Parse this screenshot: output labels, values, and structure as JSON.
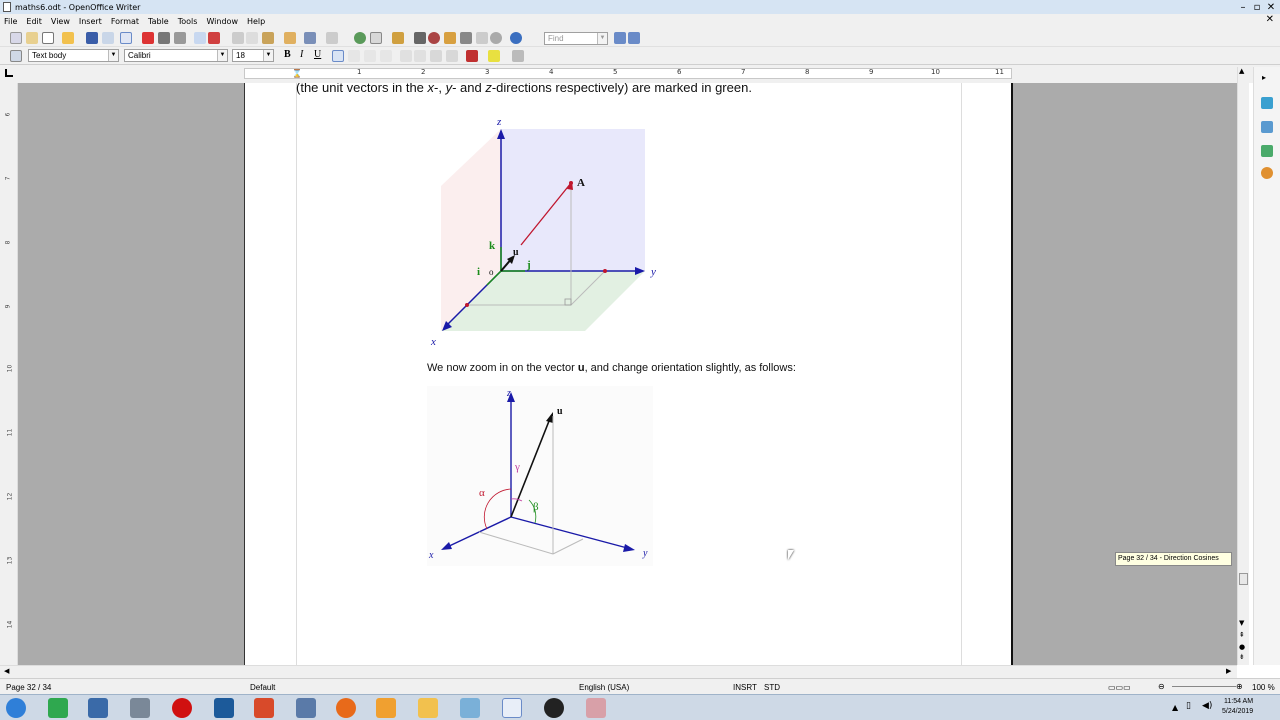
{
  "window": {
    "title": "maths6.odt - OpenOffice Writer"
  },
  "menu": [
    "File",
    "Edit",
    "View",
    "Insert",
    "Format",
    "Table",
    "Tools",
    "Window",
    "Help"
  ],
  "toolbar": {
    "find_placeholder": "Find",
    "paragraph_style": "Text body",
    "font_name": "Calibri",
    "font_size": "18",
    "bold": "B",
    "italic": "I",
    "underline": "U"
  },
  "ruler": {
    "numbers": [
      "1",
      "2",
      "3",
      "4",
      "5",
      "6",
      "7",
      "8",
      "9",
      "10",
      "11"
    ],
    "vnumbers": [
      "6",
      "7",
      "8",
      "9",
      "10",
      "11",
      "12",
      "13",
      "14"
    ]
  },
  "document": {
    "top_line_1": "(the unit vectors in the ",
    "top_x": "x",
    "top_sep1": "-, ",
    "top_y": "y",
    "top_sep2": "- and ",
    "top_z": "z",
    "top_line_2": "-directions respectively) are marked in green.",
    "para_pre": "We now zoom in on the vector ",
    "para_bold": "u",
    "para_post": ", and change orientation slightly, as follows:",
    "fig1_labels": {
      "z": "z",
      "y": "y",
      "x": "x",
      "A": "A",
      "k": "k",
      "j": "j",
      "i": "i",
      "u": "u",
      "o": "o"
    },
    "fig2_labels": {
      "z": "z",
      "y": "y",
      "x": "x",
      "u": "u",
      "alpha": "α",
      "beta": "β",
      "gamma": "γ"
    }
  },
  "tooltip": "Page 32 / 34  - Direction Cosines",
  "status": {
    "page": "Page 32 / 34",
    "style": "Default",
    "lang": "English (USA)",
    "mode": "INSRT",
    "sel": "STD",
    "zoom": "100 %"
  },
  "clock": {
    "time": "11:54 AM",
    "date": "5/24/2019"
  },
  "colors": {
    "accent_blue": "#1a1aa8",
    "green": "#1a8c1a",
    "red": "#c0162e"
  }
}
